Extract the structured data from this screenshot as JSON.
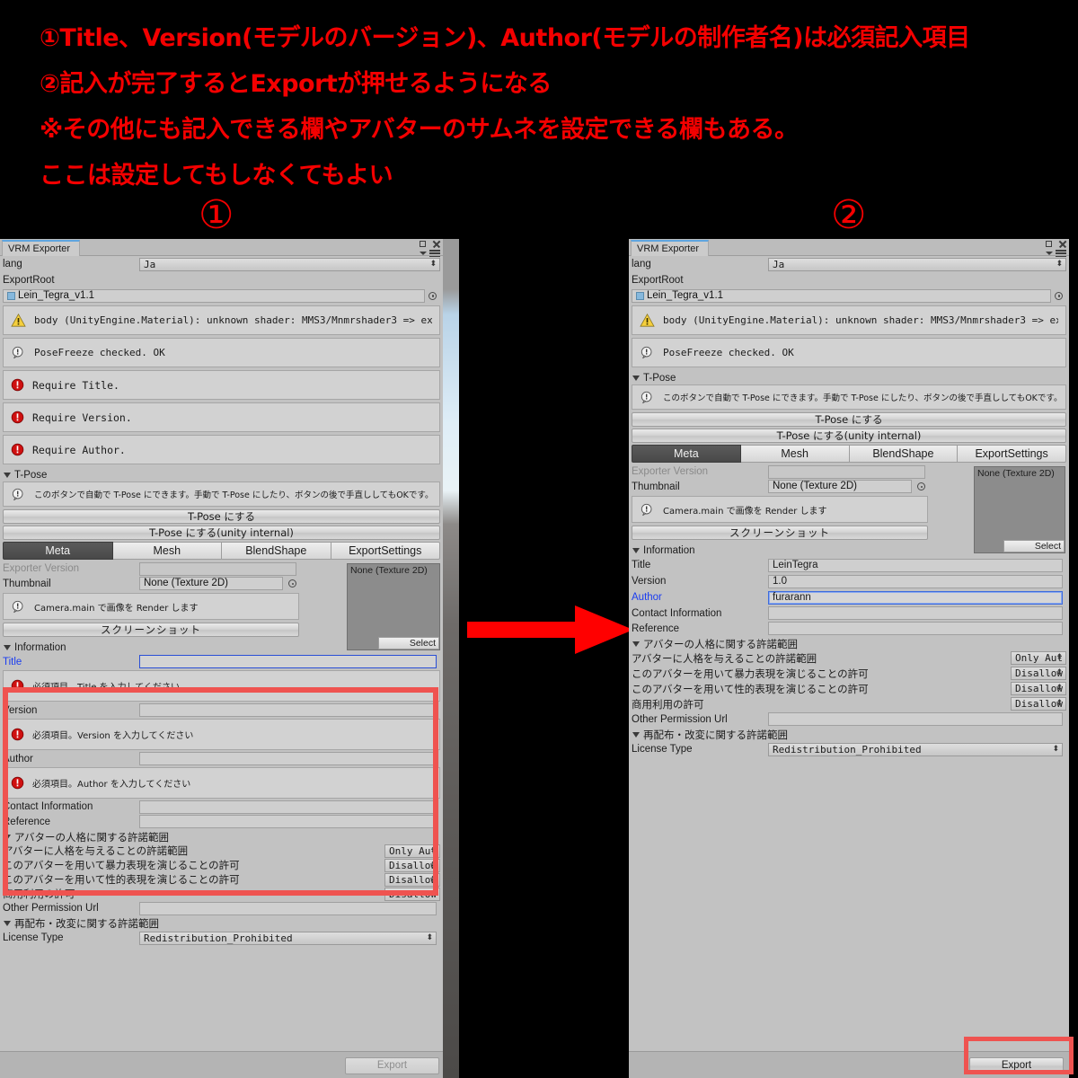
{
  "annotations": {
    "lines": [
      "①Title、Version(モデルのバージョン)、Author(モデルの制作者名)は必須記入項目",
      "②記入が完了するとExportが押せるようになる",
      "※その他にも記入できる欄やアバターのサムネを設定できる欄もある。",
      "ここは設定してもしなくてもよい"
    ],
    "marker_left": "①",
    "marker_right": "②",
    "color": "#f40000"
  },
  "left_panel": {
    "window_title": "VRM Exporter",
    "lang_label": "lang",
    "lang_value": "Ja",
    "export_root_label": "ExportRoot",
    "export_root_value": "Lein_Tegra_v1.1",
    "messages": [
      {
        "type": "warning",
        "text": "body (UnityEngine.Material): unknown shader: MMS3/Mnmrshader3 => expo"
      },
      {
        "type": "info",
        "text": "PoseFreeze checked. OK"
      },
      {
        "type": "error",
        "text": "Require Title."
      },
      {
        "type": "error",
        "text": "Require Version."
      },
      {
        "type": "error",
        "text": "Require Author."
      }
    ],
    "tpose_foldout": "T-Pose",
    "tpose_help": "このボタンで自動で T-Pose にできます。手動で T-Pose にしたり、ボタンの後で手直ししてもOKです。",
    "tpose_button": "T-Pose にする",
    "tpose_button_unity": "T-Pose にする(unity internal)",
    "tabs": [
      {
        "label": "Meta",
        "active": true
      },
      {
        "label": "Mesh",
        "active": false
      },
      {
        "label": "BlendShape",
        "active": false
      },
      {
        "label": "ExportSettings",
        "active": false
      }
    ],
    "exporter_version_label": "Exporter Version",
    "exporter_version_value": "",
    "thumbnail_label": "Thumbnail",
    "thumbnail_value": "None (Texture 2D)",
    "thumbnail_preview_caption": "None (Texture 2D)",
    "thumbnail_select_button": "Select",
    "camera_help": "Camera.main で画像を Render します",
    "screenshot_button": "スクリーンショット",
    "information_foldout": "Information",
    "title_label": "Title",
    "title_value": "",
    "title_error": "必須項目。Title を入力してください",
    "version_label": "Version",
    "version_value": "",
    "version_error": "必須項目。Version を入力してください",
    "author_label": "Author",
    "author_value": "",
    "author_error": "必須項目。Author を入力してください",
    "contact_label": "Contact Information",
    "contact_value": "",
    "reference_label": "Reference",
    "reference_value": "",
    "personality_foldout": "アバターの人格に関する許諾範囲",
    "permissions": [
      {
        "label": "アバターに人格を与えることの許諾範囲",
        "value": "Only Aut"
      },
      {
        "label": "このアバターを用いて暴力表現を演じることの許可",
        "value": "Disallow"
      },
      {
        "label": "このアバターを用いて性的表現を演じることの許可",
        "value": "Disallow"
      },
      {
        "label": "商用利用の許可",
        "value": "Disallow"
      }
    ],
    "other_permission_label": "Other Permission Url",
    "other_permission_value": "",
    "redistribution_foldout": "再配布・改変に関する許諾範囲",
    "license_type_label": "License Type",
    "license_type_value": "Redistribution_Prohibited",
    "export_button": "Export",
    "export_enabled": false
  },
  "right_panel": {
    "window_title": "VRM Exporter",
    "lang_label": "lang",
    "lang_value": "Ja",
    "export_root_label": "ExportRoot",
    "export_root_value": "Lein_Tegra_v1.1",
    "messages": [
      {
        "type": "warning",
        "text": "body (UnityEngine.Material): unknown shader: MMS3/Mnmrshader3 => expo"
      },
      {
        "type": "info",
        "text": "PoseFreeze checked. OK"
      }
    ],
    "tpose_foldout": "T-Pose",
    "tpose_help": "このボタンで自動で T-Pose にできます。手動で T-Pose にしたり、ボタンの後で手直ししてもOKです。",
    "tpose_button": "T-Pose にする",
    "tpose_button_unity": "T-Pose にする(unity internal)",
    "tabs": [
      {
        "label": "Meta",
        "active": true
      },
      {
        "label": "Mesh",
        "active": false
      },
      {
        "label": "BlendShape",
        "active": false
      },
      {
        "label": "ExportSettings",
        "active": false
      }
    ],
    "exporter_version_label": "Exporter Version",
    "exporter_version_value": "",
    "thumbnail_label": "Thumbnail",
    "thumbnail_value": "None (Texture 2D)",
    "thumbnail_preview_caption": "None (Texture 2D)",
    "thumbnail_select_button": "Select",
    "camera_help": "Camera.main で画像を Render します",
    "screenshot_button": "スクリーンショット",
    "information_foldout": "Information",
    "title_label": "Title",
    "title_value": "LeinTegra",
    "version_label": "Version",
    "version_value": "1.0",
    "author_label": "Author",
    "author_value": "furarann",
    "contact_label": "Contact Information",
    "contact_value": "",
    "reference_label": "Reference",
    "reference_value": "",
    "personality_foldout": "アバターの人格に関する許諾範囲",
    "permissions": [
      {
        "label": "アバターに人格を与えることの許諾範囲",
        "value": "Only Aut"
      },
      {
        "label": "このアバターを用いて暴力表現を演じることの許可",
        "value": "Disallow"
      },
      {
        "label": "このアバターを用いて性的表現を演じることの許可",
        "value": "Disallow"
      },
      {
        "label": "商用利用の許可",
        "value": "Disallow"
      }
    ],
    "other_permission_label": "Other Permission Url",
    "other_permission_value": "",
    "redistribution_foldout": "再配布・改変に関する許諾範囲",
    "license_type_label": "License Type",
    "license_type_value": "Redistribution_Prohibited",
    "export_button": "Export",
    "export_enabled": true
  }
}
